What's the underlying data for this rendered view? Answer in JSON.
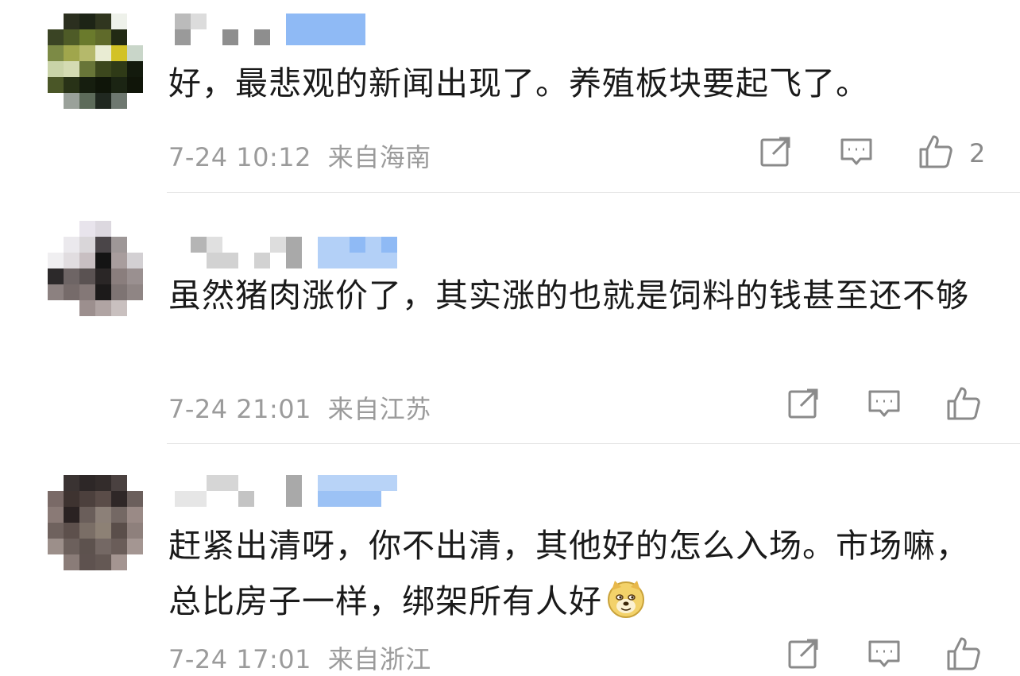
{
  "comments": [
    {
      "text": "好，最悲观的新闻出现了。养殖板块要起飞了。",
      "time": "7-24 10:12",
      "location": "来自海南",
      "like_count": "2"
    },
    {
      "text": "虽然猪肉涨价了，其实涨的也就是饲料的钱甚至还不够",
      "time": "7-24 21:01",
      "location": "来自江苏",
      "like_count": ""
    },
    {
      "text": "赶紧出清呀，你不出清，其他好的怎么入场。市场嘛，总比房子一样，绑架所有人好",
      "time": "7-24 17:01",
      "location": "来自浙江",
      "like_count": ""
    }
  ],
  "icons": {
    "share": "share-icon",
    "reply": "comment-icon",
    "like": "thumbs-up-icon",
    "emoji": "doge-emoji-icon"
  },
  "colors": {
    "text": "#1a1a1a",
    "meta": "#9b9b9b",
    "icon": "#8a8a8a",
    "divider": "#e3e3e3",
    "name_blur": "#8fbaf5"
  }
}
